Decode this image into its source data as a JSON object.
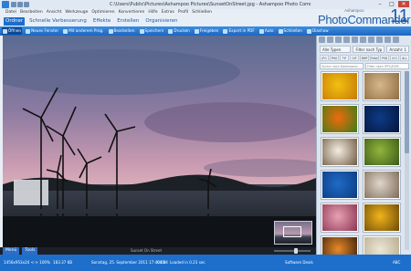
{
  "window": {
    "title": "C:\\Users\\Public\\Pictures\\Ashampoo Pictures\\SunsetOnStreet.jpg - Ashampoo Photo Commander 11",
    "controls": [
      "–",
      "□",
      "✕"
    ]
  },
  "menu": [
    "Datei",
    "Bearbeiten",
    "Ansicht",
    "Werkzeuge",
    "Optimieren",
    "Konvertieren",
    "Hilfe",
    "Extras",
    "Profil",
    "Schließen"
  ],
  "brand": {
    "small": "Ashampoo",
    "name": "PhotoCommander",
    "version": "11"
  },
  "ribbon_tabs": [
    {
      "label": "Ordner",
      "active": true
    },
    {
      "label": "Schnelle Verbesserung",
      "active": false
    },
    {
      "label": "Effekte",
      "active": false
    },
    {
      "label": "Erstellen",
      "active": false
    },
    {
      "label": "Organisieren",
      "active": false
    }
  ],
  "toolbar": [
    {
      "label": "Öffnen",
      "icon": "folder-open-icon",
      "active": true
    },
    {
      "label": "Neues Fenster",
      "icon": "window-icon",
      "active": false
    },
    {
      "label": "Mit anderem Prog.",
      "icon": "apps-icon",
      "active": false
    },
    {
      "label": "Bearbeiten",
      "icon": "edit-icon",
      "active": false
    },
    {
      "label": "Speichern",
      "icon": "save-icon",
      "active": false
    },
    {
      "label": "Drucken",
      "icon": "print-icon",
      "active": false
    },
    {
      "label": "Freigeben",
      "icon": "share-icon",
      "active": false
    },
    {
      "label": "Export in PDF",
      "icon": "pdf-icon",
      "active": false
    },
    {
      "label": "Auto",
      "icon": "wand-icon",
      "active": false
    },
    {
      "label": "Schließen",
      "icon": "close-icon",
      "active": false
    },
    {
      "label": "Diashow",
      "icon": "slideshow-icon",
      "active": false
    }
  ],
  "viewer": {
    "caption": "Sunset On Street",
    "left_tabs": [
      "Menü",
      "Tools"
    ],
    "zoom_level": 0.62
  },
  "right_panel": {
    "header": [
      "Alle Typen",
      "Filter nach Typ",
      "Anzahl: 1"
    ],
    "types": [
      "JPG",
      "PNG",
      "TIF",
      "GIF",
      "BMP",
      "RAW",
      "PSD",
      "ICO",
      "ALL"
    ],
    "filters": [
      "Suche nach Dateiname...",
      "Filter nach IPTC/EXIF..."
    ],
    "thumbnails": [
      {
        "name": "Yellow flower close-up",
        "colors": [
          "#f2c012",
          "#c77a05"
        ]
      },
      {
        "name": "Desert grass",
        "colors": [
          "#d6b78a",
          "#8f6d44"
        ]
      },
      {
        "name": "Orange lily",
        "colors": [
          "#ef6a0c",
          "#3b7d19"
        ]
      },
      {
        "name": "Blue night sky with moon",
        "colors": [
          "#0d3b86",
          "#04163d"
        ]
      },
      {
        "name": "Mushrooms",
        "colors": [
          "#f4ede3",
          "#6e5a40"
        ]
      },
      {
        "name": "Green lizard",
        "colors": [
          "#92b53c",
          "#3c5a18"
        ]
      },
      {
        "name": "Seagull in blue sky",
        "colors": [
          "#1f6bc7",
          "#0b3b80"
        ]
      },
      {
        "name": "Animal portrait",
        "colors": [
          "#e0d6cb",
          "#7d6a58"
        ]
      },
      {
        "name": "Pink roses",
        "colors": [
          "#e7a1b4",
          "#8c3552"
        ]
      },
      {
        "name": "Sunflower",
        "colors": [
          "#f2b41a",
          "#6a4a08"
        ]
      },
      {
        "name": "Sunset over field",
        "colors": [
          "#e88a28",
          "#3a1f0c"
        ]
      },
      {
        "name": "Document thumbnail",
        "colors": [
          "#ece6d5",
          "#b7ab8c"
        ]
      }
    ]
  },
  "status": {
    "dimensions": "1456x953x24 <-> 100%",
    "size": "183.37 KB",
    "date": "Sonntag, 25. September 2011 17:40:00",
    "timing": "04:34",
    "loaded": "Loaded in 0.23 sec",
    "shortcut": "Software Deals",
    "trailing": "ABC"
  },
  "colors": {
    "accent": "#1d6fcb",
    "brand": "#1f5da8",
    "close": "#c8453d"
  }
}
